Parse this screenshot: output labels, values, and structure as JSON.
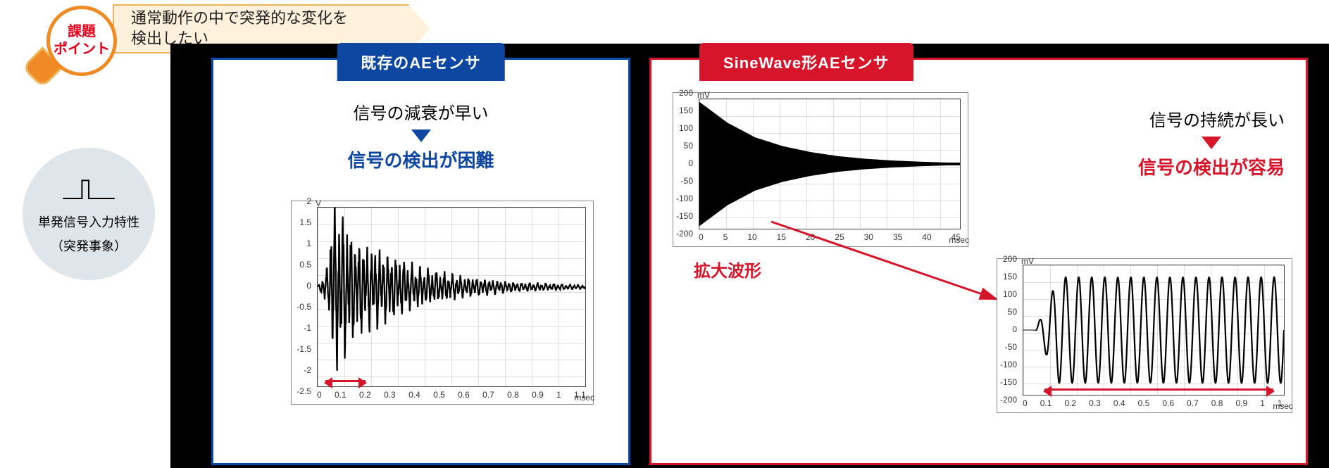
{
  "badge": {
    "line1": "課題",
    "line2": "ポイント"
  },
  "flag": {
    "line1": "通常動作の中で突発的な変化を",
    "line2": "検出したい"
  },
  "disc": {
    "line1": "単発信号入力特性",
    "line2": "（突発事象）"
  },
  "left_panel": {
    "tab": "既存のAEセンサ",
    "lead": "信号の減衰が早い",
    "conclusion": "信号の検出が困難"
  },
  "right_panel": {
    "tab": "SineWave形AEセンサ",
    "lead": "信号の持続が長い",
    "conclusion": "信号の検出が容易",
    "zoom_label": "拡大波形"
  },
  "chart_data": [
    {
      "id": "left",
      "type": "line",
      "title": "",
      "y_unit": "V",
      "x_unit": "msec",
      "y_ticks": [
        2,
        1.5,
        1,
        0.5,
        0,
        -0.5,
        -1,
        -1.5,
        -2,
        -2.5
      ],
      "x_ticks": [
        0,
        0.1,
        0.2,
        0.3,
        0.4,
        0.5,
        0.6,
        0.7,
        0.8,
        0.9,
        1,
        1.1
      ],
      "ylim": [
        -2.5,
        2
      ],
      "xlim": [
        0,
        1.1
      ],
      "highlight_span_msec": [
        0.02,
        0.2
      ],
      "description": "noisy damped burst, decays to near zero by ~0.6 msec",
      "envelope_peaks_V": [
        [
          0.05,
          2.0
        ],
        [
          0.1,
          1.8
        ],
        [
          0.15,
          1.2
        ],
        [
          0.2,
          1.0
        ],
        [
          0.3,
          0.8
        ],
        [
          0.4,
          0.5
        ],
        [
          0.6,
          0.25
        ],
        [
          0.8,
          0.12
        ],
        [
          1.1,
          0.05
        ]
      ]
    },
    {
      "id": "right_top",
      "type": "line",
      "y_unit": "mV",
      "x_unit": "msec",
      "y_ticks": [
        200,
        150,
        100,
        50,
        0,
        -50,
        -100,
        -150,
        -200
      ],
      "x_ticks": [
        0,
        5,
        10,
        15,
        20,
        25,
        30,
        35,
        40,
        45
      ],
      "ylim": [
        -220,
        220
      ],
      "xlim": [
        0,
        47
      ],
      "description": "exponentially decaying sine envelope, dense oscillation",
      "envelope_peaks_mV": [
        [
          0,
          210
        ],
        [
          5,
          140
        ],
        [
          10,
          90
        ],
        [
          15,
          60
        ],
        [
          20,
          40
        ],
        [
          25,
          26
        ],
        [
          30,
          17
        ],
        [
          35,
          11
        ],
        [
          40,
          7
        ],
        [
          45,
          4
        ]
      ]
    },
    {
      "id": "right_bottom",
      "type": "line",
      "y_unit": "mV",
      "x_unit": "msec",
      "y_ticks": [
        200,
        150,
        100,
        50,
        0,
        -50,
        -100,
        -150,
        -200
      ],
      "x_ticks": [
        0,
        0.1,
        0.2,
        0.3,
        0.4,
        0.5,
        0.6,
        0.7,
        0.8,
        0.9,
        1,
        "1."
      ],
      "ylim": [
        -220,
        220
      ],
      "xlim": [
        0,
        1.1
      ],
      "highlight_span_msec": [
        0.08,
        1.05
      ],
      "description": "steady sine ~20 cycles across window, amplitude grows quickly then ~±180 mV sustained",
      "approx_cycles": 20,
      "sustained_amplitude_mV": 180,
      "onset_msec": 0.05
    }
  ]
}
